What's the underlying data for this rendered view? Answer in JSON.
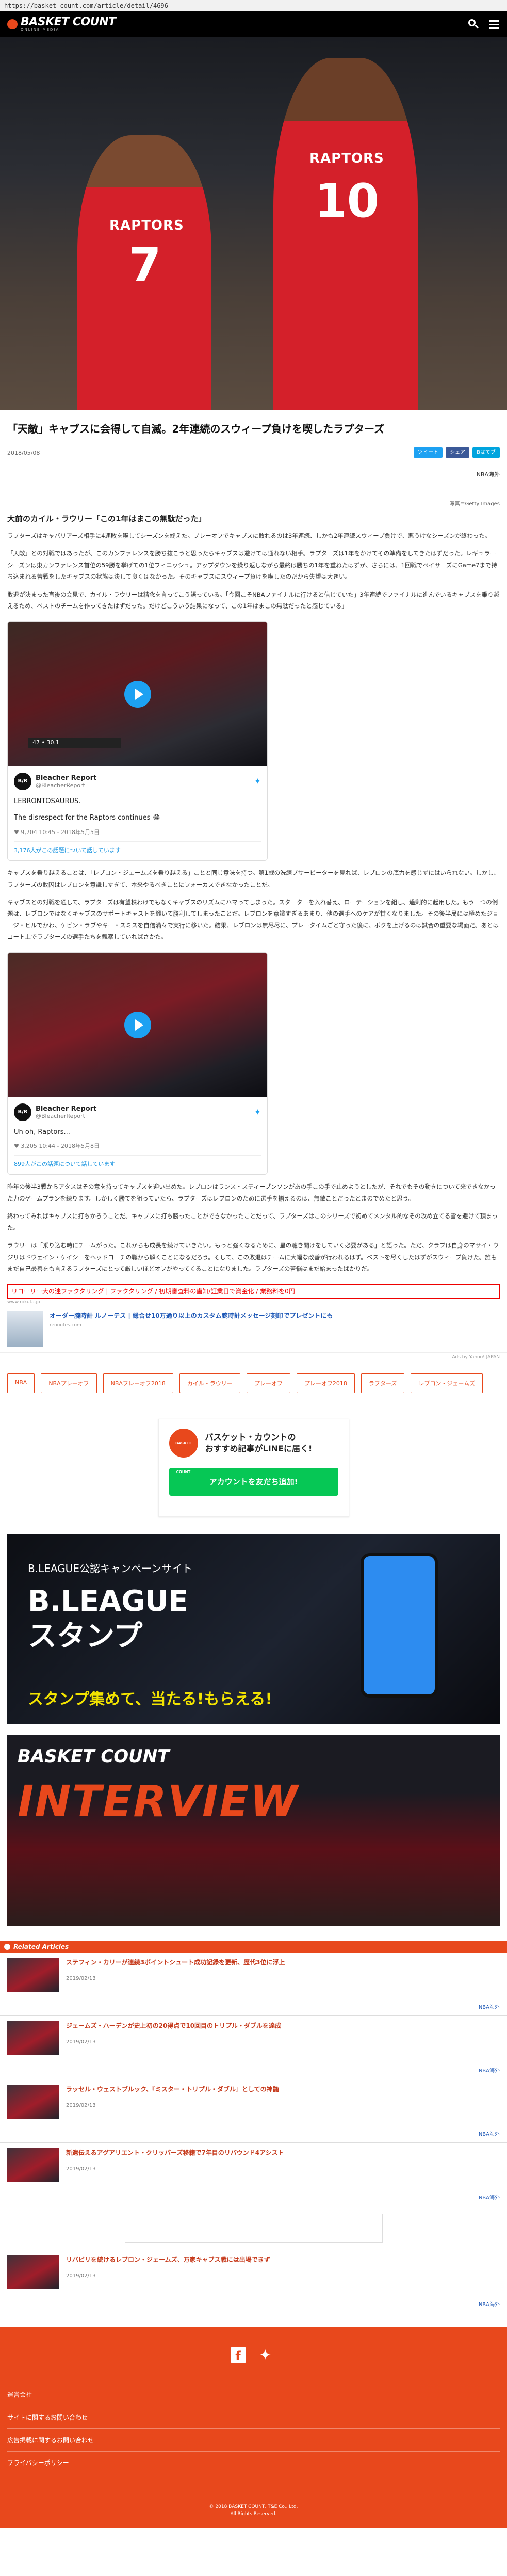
{
  "browser": {
    "url": "https://basket-count.com/article/detail/4696"
  },
  "site": {
    "logo_text": "BASKET COUNT",
    "logo_sub": "ONLINE MEDIA"
  },
  "hero": {
    "player1_word": "RAPTORS",
    "player1_no": "7",
    "player2_word": "RAPTORS",
    "player2_no": "10"
  },
  "article": {
    "title": "「天敵」キャブスに会得して自滅。2年連続のスウィープ負けを喫したラプターズ",
    "date": "2018/05/08",
    "share": {
      "twitter": "ツイート",
      "facebook": "シェア",
      "hatena": "Bはてブ"
    },
    "category": "NBA海外",
    "photo_credit": "写真＝Getty Images",
    "section_title": "大前のカイル・ラウリー「この1年はまこの無駄だった」",
    "para1": "ラプターズはキャバリアーズ相手に4連敗を喫してシーズンを終えた。ブレーオフでキャブスに敗れるのは3年連続、しかも2年連続スウィープ負けで、悪うけなシーズンが終わった。",
    "para2": "「天敵」との対戦ではあったが、このカンファレンスを勝ち抜こうと思ったらキャブスは避けては通れない相手。ラプターズは1年をかけてその準備をしてきたはずだった。レギュラーシーズンは東カンファレンス首位の59勝を挙げての1位フィニッシュ。アップダウンを繰り返しながら最終は勝ちの1年を重ねたはずが、さらには、1回戦でペイサーズにGame7まで持ち込まれる苦戦をしたキャブスの状態は決して良くはなかった。そのキャブスにスウィープ負けを喫したのだから失望は大きい。",
    "para3": "敗退が決まった直後の会見で、カイル・ラウリーは精念を言ってこう語っている。「今回こそNBAファイナルに行けると信じていた」3年連続でファイナルに進んでいるキャブスを乗り越えるため、ベストのチームを作ってきたはずだった。だけどこういう結果になって、この1年はまこの無駄だったと感じている」",
    "para4": "キャブスを乗り越えることは、「レブロン・ジェームズを乗り越える」ことと同じ意味を持つ。第1戦の洗練プサービーターを見れば、レブロンの底力を感じずにはいられない。しかし、ラプターズの敗因はレブロンを意識しすぎて、本来やるべきことにフォーカスできなかったことだ。",
    "para5": "キャブスとの対戦を通して、ラプターズは有望株わけでもなくキャブスのリズムにハマってしまった。スターターを入れ替え、ローテーションを組し、過剰的に起用した。もう一つの例題は、レブロンではなくキャブスのサポートキャストを鍛いて勝利してしまったことだ。レブロンを意識すぎるあまり、他の選手へのケアが甘くなりました。その後半局には極めたジョージ・ヒルでかわ、ケビン・ラブやキー・スミスを自信満々で実行に移いた。結果、レブロンは無尽尽に、プレータイムごと守った後に、ボクを上げるのは試合の重要な場面だ。あとはコート上でラプターズの選手たちを観察していればさかた。",
    "para6": "昨年の後半3戦からアタスはその意を持ってキャブスを迎い出めた。レブロンはランス・スティーブンソンがあの手この手で止めようとしたが、それでもその動きについて来できなかった力のゲームプランを練ります。しかしく勝てを狙っていたら、ラプターズはレブロンのために選手を揃えるのは、無敵ことだったとまのでめたと思う。",
    "para7": "終わってみればキャブスに打ちかろうことだ。キャブスに打ち勝ったことができなかったことだって、ラプターズはこのシリーズで初めてメンタル的なその攻め立てる雪を避けて頂まった。",
    "para8": "ラウリーは「乗り込む時にチームがった。これからも成長を続けていきたい。もっと強くなるために、星の聴き開けをしていく必要がある」と語った。ただ、クラブは自身のマサイ・ウジリはドウェイン・ケイシーをヘッドコーチの職から解くことになるだろう。そして、この敗退はチームに大幅な改善が行われるはず。ベストを尽くしたはずがスウィープ負けた。誰もまだ自己最善をも言えるラプターズにとって厳しいほどオフがやってくることになりました。ラプターズの苦悩はまだ始まったばかりだ。"
  },
  "tweets": [
    {
      "score": "47 • 30.1",
      "name": "Bleacher Report",
      "handle": "@BleacherReport",
      "text1": "LEBRONTOSAURUS.",
      "text2": "The disrespect for the Raptors continues 😂",
      "stats": "♥ 9,704  10:45 - 2018年5月5日",
      "link": "3,176人がこの話題について話しています"
    },
    {
      "score": "",
      "name": "Bleacher Report",
      "handle": "@BleacherReport",
      "text1": "Uh oh, Raptors...",
      "text2": "",
      "stats": "♥ 3,205  10:44 - 2018年5月8日",
      "link": "899人がこの話題について話しています"
    }
  ],
  "promo_box": {
    "text": "リヨーリー大の迷ファクタリング | ファクタリング / 初期審査料の歯知/証業日で資金化 / 業務料を0円",
    "source": "www.rokuta.jp"
  },
  "ad": {
    "title": "オーダー腕時計 ルノーテス | 総合せ10万通り以上のカスタム腕時計メッセージ刻印でプレゼントにも",
    "source": "renoutes.com",
    "ads_by": "Ads by Yahoo! JAPAN"
  },
  "tags": [
    "NBA",
    "NBAプレーオフ",
    "NBAプレーオフ2018",
    "カイル・ラウリー",
    "プレーオフ",
    "プレーオフ2018",
    "ラプターズ",
    "レブロン・ジェームズ"
  ],
  "line_card": {
    "logo": "BASKET COUNT",
    "text1": "バスケット・カウントの",
    "text2": "おすすめ記事がLINEに届く!",
    "button": "アカウントを友だち追加!"
  },
  "banner1": {
    "small": "B.LEAGUE公認キャンペーンサイト",
    "main1": "B.LEAGUE",
    "main2": "スタンプ",
    "bottom": "スタンプ集めて、当たる!もらえる!"
  },
  "banner2": {
    "logo": "BASKET COUNT",
    "interview": "INTERVIEW"
  },
  "related": {
    "heading": "Related Articles",
    "items": [
      {
        "title": "ステフィン・カリーが連続3ポイントシュート成功記録を更新、歴代3位に浮上",
        "date": "2019/02/13",
        "tag": "NBA海外"
      },
      {
        "title": "ジェームズ・ハーデンが史上初の20得点で10回目のトリプル・ダブルを達成",
        "date": "2019/02/13",
        "tag": "NBA海外"
      },
      {
        "title": "ラッセル・ウェストブルック、『ミスター・トリプル・ダブル』としての神髄",
        "date": "2019/02/13",
        "tag": "NBA海外"
      },
      {
        "title": "新遺伝えるアグアリエント・クリッパーズ移籍で7年目のリバウンド4アシスト",
        "date": "2019/02/13",
        "tag": "NBA海外"
      },
      {
        "title": "リバビリを続けるレブロン・ジェームズ、万家キャブス戦には出場できず",
        "date": "2019/02/13",
        "tag": "NBA海外"
      }
    ]
  },
  "footer": {
    "links": [
      "運営会社",
      "サイトに関するお問い合わせ",
      "広告掲載に関するお問い合わせ",
      "プライバシーポリシー"
    ],
    "copyright1": "© 2018 BASKET COUNT, T&E Co., Ltd.",
    "copyright2": "All Rights Reserved."
  }
}
